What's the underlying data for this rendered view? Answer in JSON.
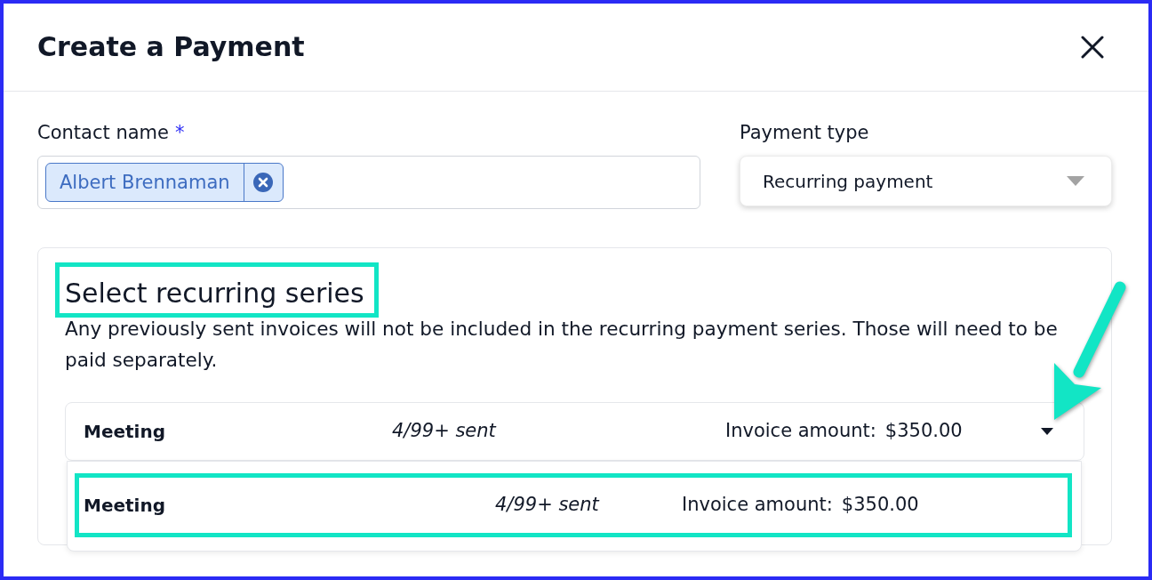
{
  "dialog": {
    "title": "Create a Payment"
  },
  "contact": {
    "label": "Contact name",
    "required_mark": "*",
    "chips": [
      {
        "label": "Albert Brennaman"
      }
    ]
  },
  "payment_type": {
    "label": "Payment type",
    "value": "Recurring payment"
  },
  "series": {
    "heading": "Select recurring series",
    "highlighted": true,
    "note": "Any previously sent invoices will not be included in the recurring payment series. Those will need to be paid separately.",
    "select": {
      "name": "Meeting",
      "sent": "4/99+ sent",
      "amount_label": "Invoice amount:",
      "amount": "$350.00",
      "expanded": true,
      "arrow_annotation": true
    },
    "options": [
      {
        "name": "Meeting",
        "sent": "4/99+ sent",
        "amount_label": "Invoice amount:",
        "amount": "$350.00",
        "highlighted": true
      }
    ]
  }
}
